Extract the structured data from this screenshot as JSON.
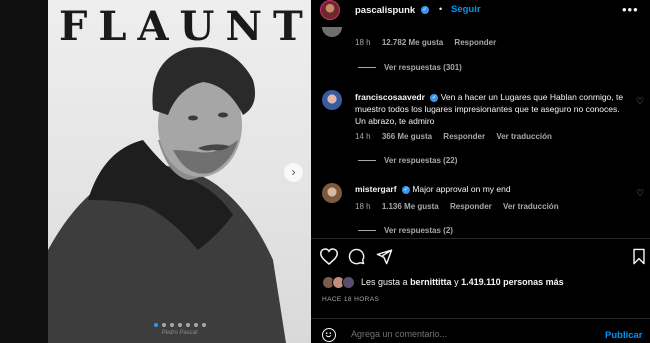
{
  "post": {
    "magazine_title": "FLAUNT",
    "photo_credit": "Pedro Pascal",
    "carousel": {
      "total": 7,
      "active_index": 0
    },
    "next_icon": "chevron-right-icon"
  },
  "header": {
    "username": "pascalispunk",
    "separator": "•",
    "follow_label": "Seguir",
    "more_icon": "ellipsis-icon"
  },
  "comments": [
    {
      "time": "18 h",
      "likes": "12.782 Me gusta",
      "reply": "Responder",
      "view_replies": "Ver respuestas (301)"
    },
    {
      "username": "franciscosaavedr",
      "text": "Ven a hacer un Lugares que Hablan conmigo, te muestro todos los lugares impresionantes que te aseguro no conoces. Un abrazo, te admiro",
      "time": "14 h",
      "likes": "366 Me gusta",
      "reply": "Responder",
      "translate": "Ver traducción",
      "view_replies": "Ver respuestas (22)"
    },
    {
      "username": "mistergarf",
      "text": "Major approval on my end",
      "time": "18 h",
      "likes": "1.136 Me gusta",
      "reply": "Responder",
      "translate": "Ver traducción",
      "view_replies": "Ver respuestas (2)"
    }
  ],
  "actions": {
    "like_icon": "heart-icon",
    "comment_icon": "comment-icon",
    "share_icon": "send-icon",
    "save_icon": "bookmark-icon"
  },
  "likes": {
    "prefix": "Les gusta a",
    "user": "bernittitta",
    "middle": "y",
    "count": "1.419.110 personas más"
  },
  "time_ago": "HACE 18 HORAS",
  "comment_box": {
    "placeholder": "Agrega un comentario...",
    "publish_label": "Publicar"
  },
  "colors": {
    "accent": "#0095f6",
    "background": "#000000",
    "secondary_text": "#a8a8a8"
  }
}
